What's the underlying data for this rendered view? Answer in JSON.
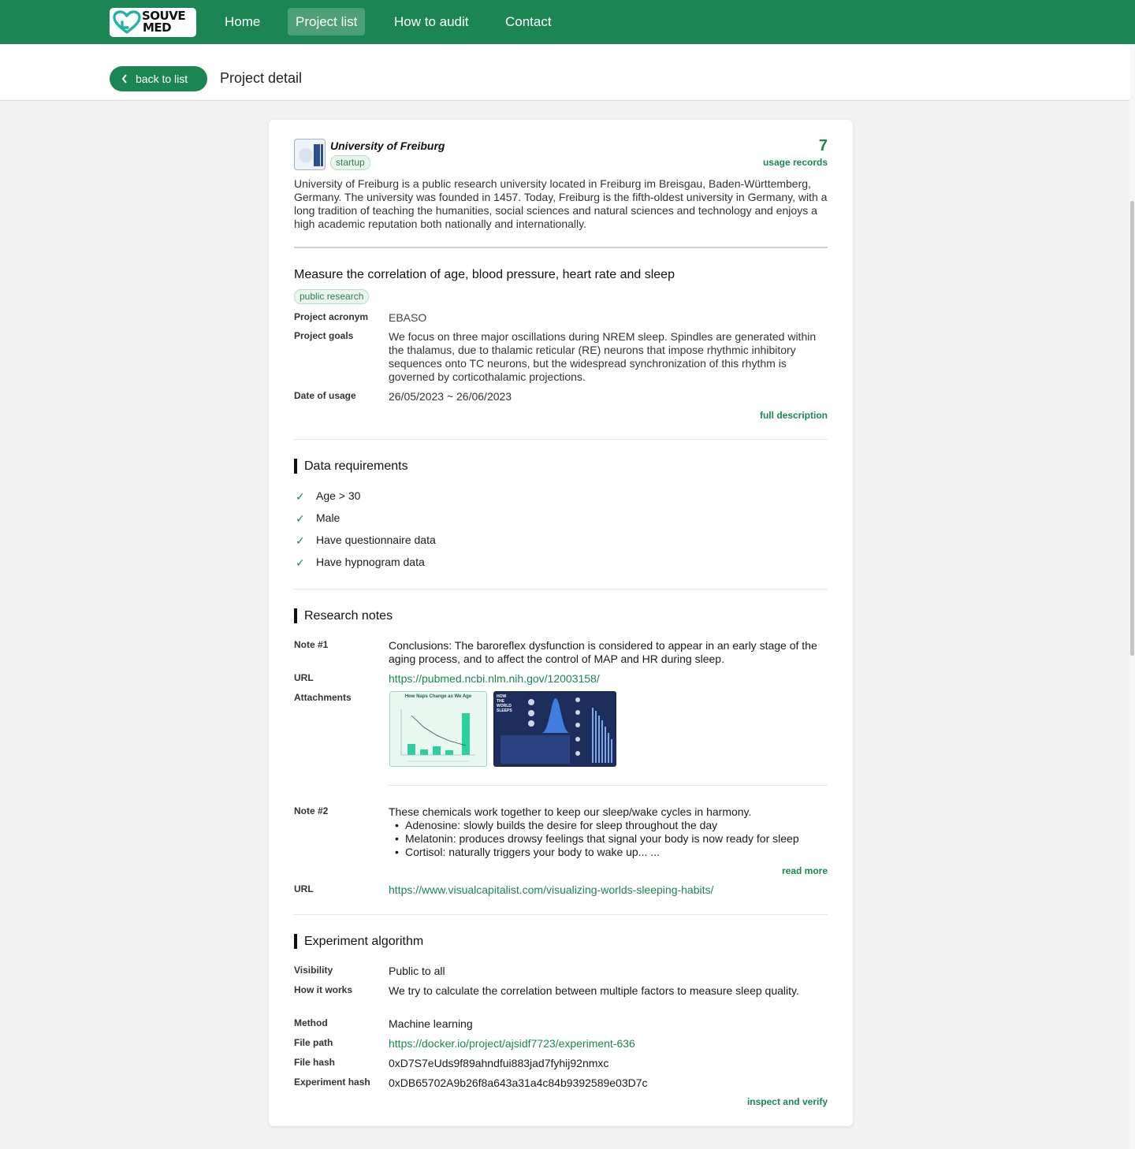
{
  "nav": {
    "logo_line1": "SOUVE",
    "logo_line2": "MED",
    "items": [
      {
        "label": "Home"
      },
      {
        "label": "Project list",
        "active": true
      },
      {
        "label": "How to audit"
      },
      {
        "label": "Contact"
      }
    ]
  },
  "subheader": {
    "back_label": "back to list",
    "title": "Project detail"
  },
  "org": {
    "name": "University of Freiburg",
    "tag": "startup",
    "usage_count": "7",
    "usage_label": "usage records",
    "description": "University of Freiburg is a public research university located in Freiburg im Breisgau, Baden-Württemberg, Germany. The university was founded in 1457. Today, Freiburg is the fifth-oldest university in Germany, with a long tradition of teaching the humanities, social sciences and natural sciences and technology and enjoys a high academic reputation both nationally and internationally."
  },
  "project": {
    "title": "Measure the correlation of age, blood pressure, heart rate and sleep",
    "tag": "public research",
    "acronym_label": "Project acronym",
    "acronym": "EBASO",
    "goals_label": "Project goals",
    "goals": "We focus on three major oscillations during NREM sleep. Spindles are generated within the thalamus, due to thalamic reticular (RE) neurons that impose rhythmic inhibitory sequences onto TC neurons, but the widespread synchronization of this rhythm is governed by corticothalamic projections.",
    "date_label": "Date of usage",
    "date": "26/05/2023 ~ 26/06/2023",
    "full_desc_link": "full description"
  },
  "requirements": {
    "title": "Data requirements",
    "items": [
      "Age > 30",
      "Male",
      "Have questionnaire data",
      "Have hypnogram data"
    ]
  },
  "notes": {
    "title": "Research notes",
    "note1": {
      "label": "Note #1",
      "text": "Conclusions: The baroreflex dysfunction is considered to appear in an early stage of the aging process, and to affect the control of MAP and HR during sleep.",
      "url_label": "URL",
      "url": "https://pubmed.ncbi.nlm.nih.gov/12003158/",
      "attachments_label": "Attachments",
      "attachment1_title": "How Naps Change as We Age",
      "attachment2_title": "HOW THE WORLD SLEEPS"
    },
    "note2": {
      "label": "Note #2",
      "intro": "These chemicals work together to keep our sleep/wake cycles in harmony.",
      "bullets": [
        "Adenosine: slowly builds the desire for sleep throughout the day",
        "Melatonin: produces drowsy feelings that signal your body is now ready for sleep",
        "Cortisol: naturally triggers your body to wake up... ..."
      ],
      "read_more": "read more",
      "url_label": "URL",
      "url": "https://www.visualcapitalist.com/visualizing-worlds-sleeping-habits/"
    }
  },
  "algorithm": {
    "title": "Experiment algorithm",
    "visibility_label": "Visibility",
    "visibility": "Public to all",
    "how_label": "How it works",
    "how": "We try to calculate the correlation between multiple factors to measure sleep quality.",
    "method_label": "Method",
    "method": "Machine learning",
    "file_path_label": "File path",
    "file_path": "https://docker.io/project/ajsidf7723/experiment-636",
    "file_hash_label": "File hash",
    "file_hash": "0xD7S7eUds9f89ahndfui883jad7fyhij92nmxc",
    "exp_hash_label": "Experiment hash",
    "exp_hash": "0xDB65702A9b26f8a643a31a4c84b9392589e03D7c",
    "inspect_link": "inspect and verify"
  },
  "colors": {
    "brand_green": "#1b8553",
    "page_bg": "#f2f2f2"
  }
}
